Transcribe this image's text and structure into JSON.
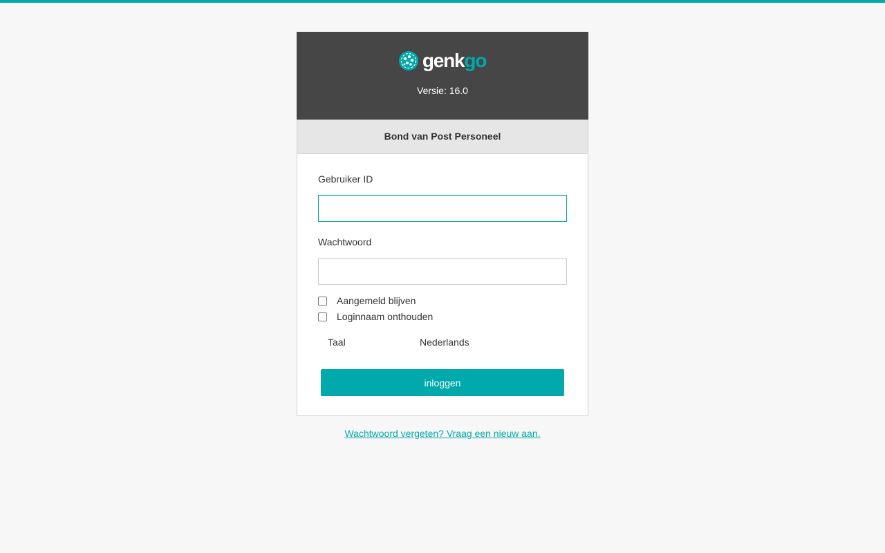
{
  "colors": {
    "accent": "#00a9ac",
    "header_bg": "#464646",
    "org_bar_bg": "#e6e6e6",
    "page_bg": "#f7f7f7"
  },
  "brand": {
    "logo_icon": "genkgo-logo-icon",
    "logo_text_part1": "genk",
    "logo_text_part2": "go",
    "version": "Versie: 16.0"
  },
  "organization": {
    "name": "Bond van Post Personeel"
  },
  "form": {
    "user_id_label": "Gebruiker ID",
    "user_id_value": "",
    "password_label": "Wachtwoord",
    "password_value": "",
    "remember_login_label": "Aangemeld blijven",
    "remember_login_checked": false,
    "remember_username_label": "Loginnaam onthouden",
    "remember_username_checked": false,
    "language_label": "Taal",
    "language_value": "Nederlands",
    "submit_label": "inloggen"
  },
  "footer": {
    "forgot_password_link": "Wachtwoord vergeten? Vraag een nieuw aan."
  }
}
